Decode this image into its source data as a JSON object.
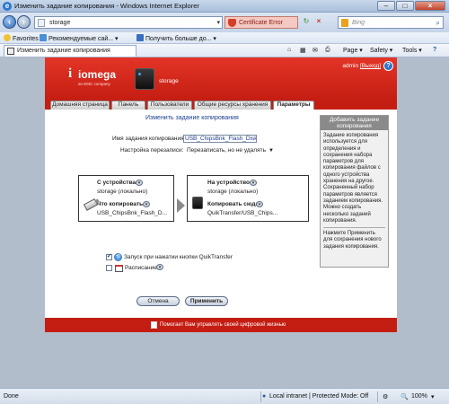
{
  "window": {
    "title": "Изменить задание копирования - Windows Internet Explorer"
  },
  "addressbar": {
    "url": "storage",
    "cert_error": "Certificate Error",
    "search_placeholder": "Bing"
  },
  "favorites_bar": {
    "favorites_label": "Favorites",
    "item1": "Рекомендуемые сай...",
    "item2": "Получить больше до..."
  },
  "command_bar": {
    "tab_title": "Изменить задание копирования",
    "page_menu": "Page ▾",
    "safety_menu": "Safety ▾",
    "tools_menu": "Tools ▾",
    "help_menu": "?"
  },
  "app": {
    "brand": "iomega",
    "brand_sub": "an EMC company",
    "device_name": "storage",
    "user": "admin",
    "logout": "[Выход]",
    "tabs": [
      {
        "label": "Домашняя страница"
      },
      {
        "label": "Панель"
      },
      {
        "label": "Пользователи"
      },
      {
        "label": "Общие ресурсы хранения"
      },
      {
        "label": "Параметры"
      }
    ],
    "form": {
      "title": "Изменить задание копирования",
      "job_name_label": "Имя задания копирования:",
      "job_name_value": "USB_ChipsBnk_Flash_Disk_",
      "overwrite_label": "Настройка перезаписи:",
      "overwrite_value": "Перезаписать, но не удалять",
      "from_device_label": "С устройства:",
      "from_device_value": "storage (локально)",
      "what_copy_label": "Что копировать:",
      "what_copy_value": "USB_ChipsBnk_Flash_D...",
      "to_device_label": "На устройство:",
      "to_device_value": "storage (локально)",
      "copy_to_label": "Копировать сюда:",
      "copy_to_value": "QuikTransfer/USB_Chips...",
      "quiktransfer_label": "Запуск при нажатии кнопки QuikTransfer",
      "quiktransfer_checked": true,
      "schedule_label": "Расписание",
      "schedule_checked": false,
      "cancel_label": "Отмена",
      "apply_label": "Применить"
    },
    "sidebar": {
      "header": "Добавить задание копирования",
      "body": "Задание копирования используется для определения и сохранения набора параметров для копирования файлов с одного устройства хранения на другое. Сохраненный набор параметров является заданием копирования. Можно создать несколько заданий копирования.",
      "hint": "Нажмите Применить для сохранения нового задания копирования."
    },
    "footer": "Помогает Вам управлять своей цифровой жизнью"
  },
  "statusbar": {
    "status": "Done",
    "zone": "Local intranet | Protected Mode: Off",
    "zoom": "100%"
  }
}
